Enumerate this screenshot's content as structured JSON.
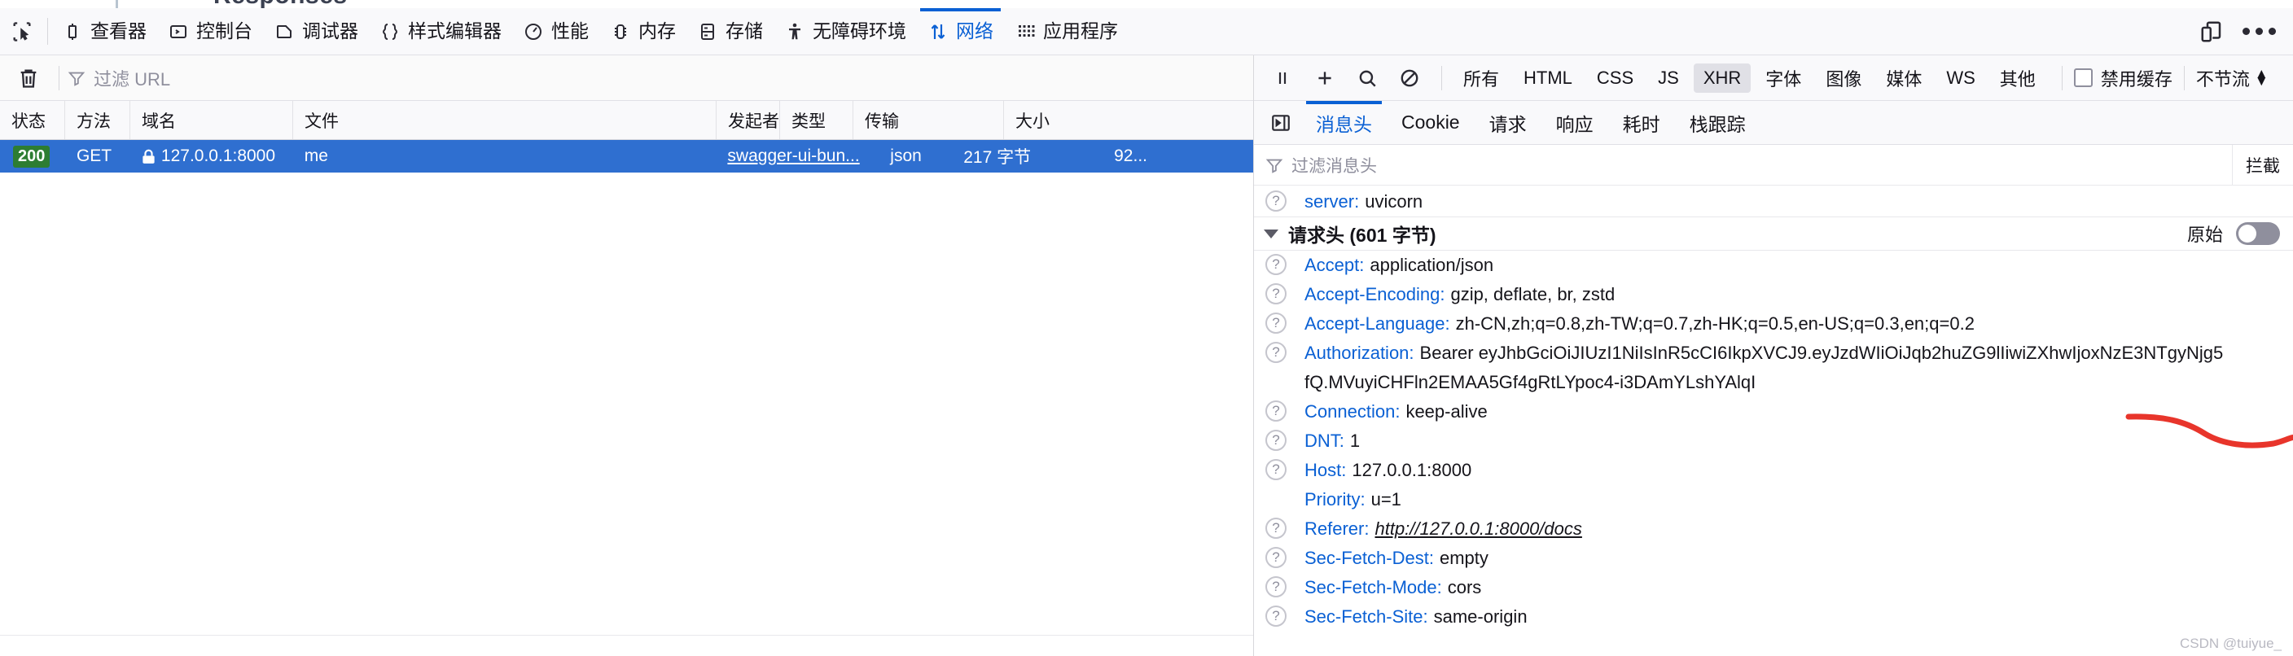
{
  "page_bleed": {
    "heading": "Responses"
  },
  "toolbar": {
    "picker_icon": "element-picker-icon",
    "tabs": [
      {
        "label": "查看器",
        "icon": "inspector-icon",
        "active": false
      },
      {
        "label": "控制台",
        "icon": "console-icon",
        "active": false
      },
      {
        "label": "调试器",
        "icon": "debugger-icon",
        "active": false
      },
      {
        "label": "样式编辑器",
        "icon": "style-editor-icon",
        "active": false
      },
      {
        "label": "性能",
        "icon": "performance-icon",
        "active": false
      },
      {
        "label": "内存",
        "icon": "memory-icon",
        "active": false
      },
      {
        "label": "存储",
        "icon": "storage-icon",
        "active": false
      },
      {
        "label": "无障碍环境",
        "icon": "accessibility-icon",
        "active": false
      },
      {
        "label": "网络",
        "icon": "network-icon",
        "active": true
      },
      {
        "label": "应用程序",
        "icon": "application-icon",
        "active": false
      }
    ],
    "responsive_icon": "responsive-design-mode-icon",
    "more_icon": "more-options-icon"
  },
  "left_pane": {
    "filter_bar": {
      "trash_icon": "trash-icon",
      "filter_icon": "funnel-icon",
      "url_filter_placeholder": "过滤 URL"
    },
    "columns": [
      {
        "key": "status",
        "label": "状态"
      },
      {
        "key": "method",
        "label": "方法"
      },
      {
        "key": "domain",
        "label": "域名"
      },
      {
        "key": "file",
        "label": "文件"
      },
      {
        "key": "initiator",
        "label": "发起者"
      },
      {
        "key": "type",
        "label": "类型"
      },
      {
        "key": "transfer",
        "label": "传输"
      },
      {
        "key": "size",
        "label": "大小"
      }
    ],
    "rows": [
      {
        "status": "200",
        "method": "GET",
        "domain": "127.0.0.1:8000",
        "file": "me",
        "initiator": "swagger-ui-bun...",
        "type": "json",
        "transfer": "217 字节",
        "size": "92...",
        "secure_icon": "lock-icon",
        "selected": true
      }
    ]
  },
  "right_pane": {
    "net_toolbar": {
      "pause_icon": "pause-icon",
      "plus_icon": "plus-icon",
      "search_icon": "search-icon",
      "block_icon": "no-entry-icon",
      "filters": [
        {
          "label": "所有",
          "active": false
        },
        {
          "label": "HTML",
          "active": false
        },
        {
          "label": "CSS",
          "active": false
        },
        {
          "label": "JS",
          "active": false
        },
        {
          "label": "XHR",
          "active": true
        },
        {
          "label": "字体",
          "active": false
        },
        {
          "label": "图像",
          "active": false
        },
        {
          "label": "媒体",
          "active": false
        },
        {
          "label": "WS",
          "active": false
        },
        {
          "label": "其他",
          "active": false
        }
      ],
      "disable_cache_label": "禁用缓存",
      "disable_cache_checked": false,
      "throttle_label": "不节流"
    },
    "detail_tabs": {
      "collapse_icon": "panel-toggle-icon",
      "tabs": [
        {
          "label": "消息头",
          "active": true
        },
        {
          "label": "Cookie",
          "active": false
        },
        {
          "label": "请求",
          "active": false
        },
        {
          "label": "响应",
          "active": false
        },
        {
          "label": "耗时",
          "active": false
        },
        {
          "label": "栈跟踪",
          "active": false
        }
      ]
    },
    "header_filter": {
      "filter_icon": "funnel-icon",
      "placeholder": "过滤消息头",
      "block_label": "拦截"
    },
    "top_headers": [
      {
        "name": "server",
        "value": "uvicorn",
        "help": true
      }
    ],
    "request_section": {
      "title": "请求头 (601 字节)",
      "raw_label": "原始",
      "raw_on": false,
      "headers": [
        {
          "name": "Accept",
          "value": "application/json",
          "help": true
        },
        {
          "name": "Accept-Encoding",
          "value": "gzip, deflate, br, zstd",
          "help": true
        },
        {
          "name": "Accept-Language",
          "value": "zh-CN,zh;q=0.8,zh-TW;q=0.7,zh-HK;q=0.5,en-US;q=0.3,en;q=0.2",
          "help": true
        },
        {
          "name": "Authorization",
          "value": "Bearer eyJhbGciOiJIUzI1NiIsInR5cCI6IkpXVCJ9.eyJzdWIiOiJqb2huZG9lIiwiZXhwIjoxNzE3NTgyNjg5",
          "help": true,
          "wrap_line": "fQ.MVuyiCHFln2EMAA5Gf4gRtLYpoc4-i3DAmYLshYAlqI"
        },
        {
          "name": "Connection",
          "value": "keep-alive",
          "help": true
        },
        {
          "name": "DNT",
          "value": "1",
          "help": true
        },
        {
          "name": "Host",
          "value": "127.0.0.1:8000",
          "help": true
        },
        {
          "name": "Priority",
          "value": "u=1",
          "help": false
        },
        {
          "name": "Referer",
          "value": "http://127.0.0.1:8000/docs",
          "help": true,
          "style": "link"
        },
        {
          "name": "Sec-Fetch-Dest",
          "value": "empty",
          "help": true
        },
        {
          "name": "Sec-Fetch-Mode",
          "value": "cors",
          "help": true
        },
        {
          "name": "Sec-Fetch-Site",
          "value": "same-origin",
          "help": true
        }
      ]
    }
  },
  "annotation": {
    "type": "red-ink-underline",
    "color": "#e8352b"
  },
  "watermark": "CSDN @tuiyue_"
}
